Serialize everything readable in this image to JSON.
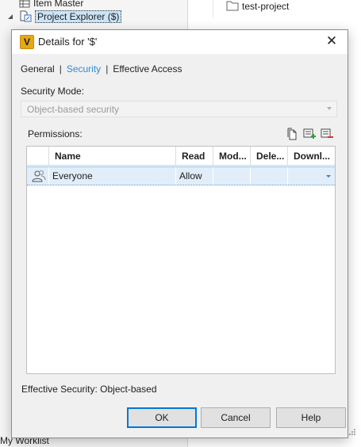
{
  "background": {
    "tree": [
      {
        "label": "Item Master",
        "icon": "table-icon"
      },
      {
        "label": "Project Explorer ($)",
        "icon": "folder-link-icon",
        "selected": true
      }
    ],
    "folder_item": {
      "label": "test-project",
      "icon": "folder-icon"
    },
    "bottom_label": "My Worklist"
  },
  "dialog": {
    "title": "Details for '$'",
    "app_icon_letter": "V",
    "close_glyph": "✕",
    "tabs": [
      {
        "label": "General",
        "active": false
      },
      {
        "label": "Security",
        "active": true
      },
      {
        "label": "Effective Access",
        "active": false
      }
    ],
    "tab_separator": "|",
    "security_mode_label": "Security Mode:",
    "security_mode_value": "Object-based security",
    "permissions_label": "Permissions:",
    "toolbar": [
      "copy-icon",
      "add-entry-icon",
      "remove-entry-icon"
    ],
    "table": {
      "columns": [
        "Name",
        "Read",
        "Mod...",
        "Dele...",
        "Downl..."
      ],
      "rows": [
        {
          "icon": "user-group-icon",
          "name": "Everyone",
          "read": "Allow",
          "modify": "",
          "delete": "",
          "download": ""
        }
      ]
    },
    "effective_security": "Effective Security: Object-based",
    "buttons": {
      "ok": "OK",
      "cancel": "Cancel",
      "help": "Help"
    }
  },
  "colors": {
    "accent": "#2e8ad8",
    "selection": "#e1eef9",
    "app_icon": "#e6a817",
    "default_button_border": "#0078d7"
  }
}
